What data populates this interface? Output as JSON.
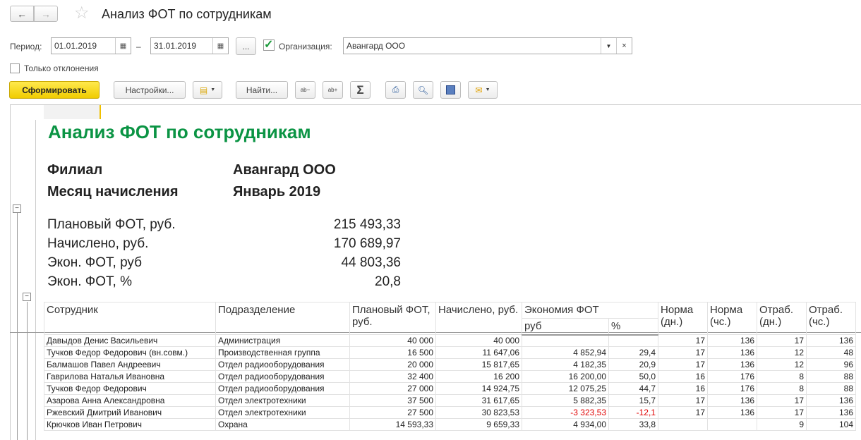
{
  "window": {
    "title": "Анализ ФОТ по сотрудникам",
    "back": "←",
    "forward": "→"
  },
  "filters": {
    "period_label": "Период:",
    "date_from": "01.01.2019",
    "dash": "–",
    "date_to": "31.01.2019",
    "more": "...",
    "org_checked": true,
    "org_label": "Организация:",
    "org_value": "Авангард ООО",
    "only_dev_label": "Только отклонения"
  },
  "toolbar": {
    "generate": "Сформировать",
    "settings": "Настройки...",
    "find": "Найти...",
    "sum": "Σ"
  },
  "report": {
    "title": "Анализ ФОТ по сотрудникам",
    "branch_label": "Филиал",
    "branch_value": "Авангард ООО",
    "month_label": "Месяц начисления",
    "month_value": "Январь 2019",
    "summary": [
      {
        "label": "Плановый ФОТ, руб.",
        "value": "215 493,33"
      },
      {
        "label": "Начислено, руб.",
        "value": "170 689,97"
      },
      {
        "label": "Экон. ФОТ, руб",
        "value": "44 803,36"
      },
      {
        "label": "Экон. ФОТ, %",
        "value": "20,8"
      }
    ],
    "headers": {
      "employee": "Сотрудник",
      "dept": "Подразделение",
      "plan": "Плановый ФОТ, руб.",
      "accrued": "Начислено, руб.",
      "economy": "Экономия ФОТ",
      "eco_rub": "руб",
      "eco_pct": "%",
      "norm_d": "Норма (дн.)",
      "norm_h": "Норма (чс.)",
      "work_d": "Отраб. (дн.)",
      "work_h": "Отраб. (чс.)"
    },
    "rows": [
      [
        "Давыдов Денис Васильевич",
        "Администрация",
        "40 000",
        "40 000",
        "",
        "",
        "17",
        "136",
        "17",
        "136"
      ],
      [
        "Тучков Федор Федорович (вн.совм.)",
        "Производственная группа",
        "16 500",
        "11 647,06",
        "4 852,94",
        "29,4",
        "17",
        "136",
        "12",
        "48"
      ],
      [
        "Балмашов Павел Андреевич",
        "Отдел радиооборудования",
        "20 000",
        "15 817,65",
        "4 182,35",
        "20,9",
        "17",
        "136",
        "12",
        "96"
      ],
      [
        "Гаврилова Наталья Ивановна",
        "Отдел радиооборудования",
        "32 400",
        "16 200",
        "16 200,00",
        "50,0",
        "16",
        "176",
        "8",
        "88"
      ],
      [
        "Тучков Федор Федорович",
        "Отдел радиооборудования",
        "27 000",
        "14 924,75",
        "12 075,25",
        "44,7",
        "16",
        "176",
        "8",
        "88"
      ],
      [
        "Азарова Анна Александровна",
        "Отдел электротехники",
        "37 500",
        "31 617,65",
        "5 882,35",
        "15,7",
        "17",
        "136",
        "17",
        "136"
      ],
      [
        "Ржевский Дмитрий Иванович",
        "Отдел электротехники",
        "27 500",
        "30 823,53",
        "-3 323,53",
        "-12,1",
        "17",
        "136",
        "17",
        "136"
      ],
      [
        "Крючков Иван Петрович",
        "Охрана",
        "14 593,33",
        "9 659,33",
        "4 934,00",
        "33,8",
        "",
        "",
        "9",
        "104"
      ]
    ],
    "colors": {
      "title": "#0b9444",
      "negative": "#e00000",
      "generate": "#f5d31a"
    }
  }
}
